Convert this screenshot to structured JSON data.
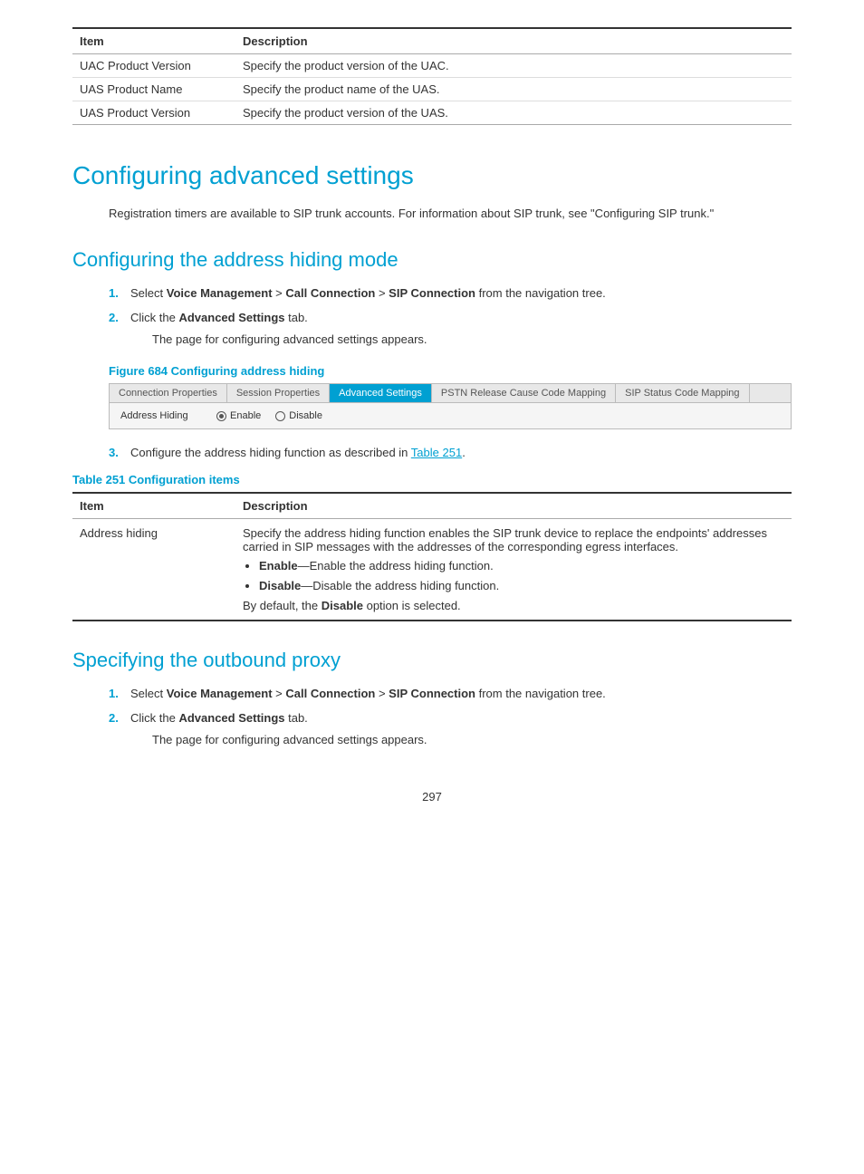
{
  "top_table": {
    "headers": [
      "Item",
      "Description"
    ],
    "rows": [
      {
        "item": "UAC Product Version",
        "desc": "Specify the product version of the UAC."
      },
      {
        "item": "UAS Product Name",
        "desc": "Specify the product name of the UAS."
      },
      {
        "item": "UAS Product Version",
        "desc": "Specify the product version of the UAS."
      }
    ]
  },
  "section_advanced": {
    "title": "Configuring advanced settings",
    "body": "Registration timers are available to SIP trunk accounts. For information about SIP trunk, see \"Configuring SIP trunk.\""
  },
  "section_hiding": {
    "title": "Configuring the address hiding mode",
    "steps": [
      {
        "num": "1.",
        "text_parts": [
          {
            "text": "Select ",
            "bold": false
          },
          {
            "text": "Voice Management",
            "bold": true
          },
          {
            "text": " > ",
            "bold": false
          },
          {
            "text": "Call Connection",
            "bold": true
          },
          {
            "text": " > ",
            "bold": false
          },
          {
            "text": "SIP Connection",
            "bold": true
          },
          {
            "text": " from the navigation tree.",
            "bold": false
          }
        ]
      },
      {
        "num": "2.",
        "text_parts": [
          {
            "text": "Click the ",
            "bold": false
          },
          {
            "text": "Advanced Settings",
            "bold": true
          },
          {
            "text": " tab.",
            "bold": false
          }
        ],
        "sub": "The page for configuring advanced settings appears."
      }
    ],
    "figure_caption": "Figure 684 Configuring address hiding",
    "figure_tabs": [
      {
        "label": "Connection Properties",
        "active": false
      },
      {
        "label": "Session Properties",
        "active": false
      },
      {
        "label": "Advanced Settings",
        "active": true
      },
      {
        "label": "PSTN Release Cause Code Mapping",
        "active": false
      },
      {
        "label": "SIP Status Code Mapping",
        "active": false
      }
    ],
    "figure_row": {
      "label": "Address Hiding",
      "options": [
        {
          "label": "Enable",
          "selected": true
        },
        {
          "label": "Disable",
          "selected": false
        }
      ]
    },
    "step3": {
      "num": "3.",
      "text_before": "Configure the address hiding function as described in ",
      "link": "Table 251",
      "text_after": "."
    }
  },
  "table251": {
    "caption": "Table 251 Configuration items",
    "headers": [
      "Item",
      "Description"
    ],
    "rows": [
      {
        "item": "Address hiding",
        "desc_intro": "Specify the address hiding function enables the SIP trunk device to replace the endpoints' addresses carried in SIP messages with the addresses of the corresponding egress interfaces.",
        "bullets": [
          {
            "bold_part": "Enable",
            "rest": "—Enable the address hiding function."
          },
          {
            "bold_part": "Disable",
            "rest": "—Disable the address hiding function."
          }
        ],
        "desc_footer_before": "By default, the ",
        "desc_footer_bold": "Disable",
        "desc_footer_after": " option is selected."
      }
    ]
  },
  "section_proxy": {
    "title": "Specifying the outbound proxy",
    "steps": [
      {
        "num": "1.",
        "text_parts": [
          {
            "text": "Select ",
            "bold": false
          },
          {
            "text": "Voice Management",
            "bold": true
          },
          {
            "text": " > ",
            "bold": false
          },
          {
            "text": "Call Connection",
            "bold": true
          },
          {
            "text": " > ",
            "bold": false
          },
          {
            "text": "SIP Connection",
            "bold": true
          },
          {
            "text": " from the navigation tree.",
            "bold": false
          }
        ]
      },
      {
        "num": "2.",
        "text_parts": [
          {
            "text": "Click the ",
            "bold": false
          },
          {
            "text": "Advanced Settings",
            "bold": true
          },
          {
            "text": " tab.",
            "bold": false
          }
        ],
        "sub": "The page for configuring advanced settings appears."
      }
    ]
  },
  "page_number": "297"
}
